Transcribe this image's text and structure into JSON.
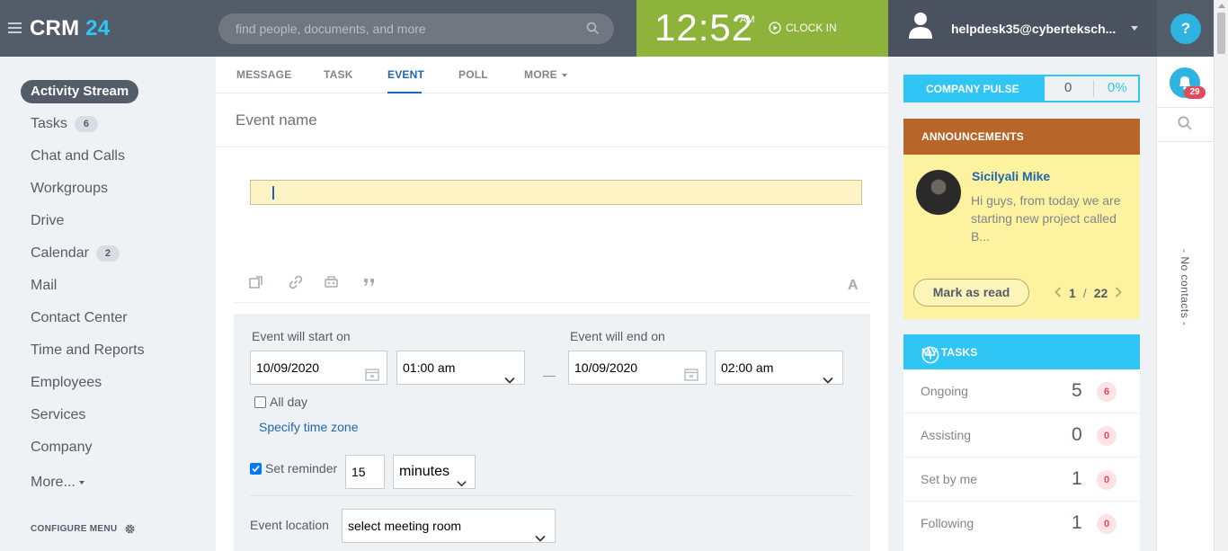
{
  "header": {
    "logo_main": "CRM",
    "logo_num": "24",
    "search_placeholder": "find people, documents, and more",
    "time": "12:52",
    "ampm": "AM",
    "clock_in": "CLOCK IN",
    "user": "helpdesk35@cyberteksch...",
    "help": "?"
  },
  "menu": {
    "active": "Activity Stream",
    "items": [
      {
        "label": "Tasks",
        "count": "6"
      },
      {
        "label": "Chat and Calls"
      },
      {
        "label": "Workgroups"
      },
      {
        "label": "Drive"
      },
      {
        "label": "Calendar",
        "count": "2"
      },
      {
        "label": "Mail"
      },
      {
        "label": "Contact Center"
      },
      {
        "label": "Time and Reports"
      },
      {
        "label": "Employees"
      },
      {
        "label": "Services"
      },
      {
        "label": "Company"
      }
    ],
    "more": "More...",
    "configure": "CONFIGURE MENU"
  },
  "form": {
    "tabs": [
      "MESSAGE",
      "TASK",
      "EVENT",
      "POLL",
      "MORE"
    ],
    "active_tab": "EVENT",
    "event_name_placeholder": "Event name",
    "format_label": "A",
    "start_label": "Event will start on",
    "end_label": "Event will end on",
    "start_date": "10/09/2020",
    "start_time": "01:00 am",
    "end_date": "10/09/2020",
    "end_time": "02:00 am",
    "dash": "—",
    "all_day": "All day",
    "all_day_checked": false,
    "timezone_link": "Specify time zone",
    "reminder_label": "Set reminder",
    "reminder_checked": true,
    "reminder_value": "15",
    "reminder_unit": "minutes",
    "location_label": "Event location",
    "location_value": "select meeting room"
  },
  "right": {
    "pulse_title": "COMPANY PULSE",
    "pulse_value": "0",
    "pulse_percent": "0%",
    "ann_title": "ANNOUNCEMENTS",
    "ann_author": "Sicilyali Mike",
    "ann_text": "Hi guys, from today we are starting new project called B...",
    "ann_button": "Mark as read",
    "ann_page": "1",
    "ann_sep": "/",
    "ann_total": "22",
    "tasks_title": "MY TASKS",
    "tasks": [
      {
        "name": "Ongoing",
        "count": "5",
        "badge": "6"
      },
      {
        "name": "Assisting",
        "count": "0",
        "badge": "0"
      },
      {
        "name": "Set by me",
        "count": "1",
        "badge": "0"
      },
      {
        "name": "Following",
        "count": "1",
        "badge": "0"
      }
    ]
  },
  "sidebar_right": {
    "notifications": "29",
    "no_contacts": "- No contacts -"
  },
  "colors": {
    "accent": "#2fc6f6",
    "clock_green": "#8db33b",
    "announcement_head": "#b8652a",
    "link": "#2067b0"
  }
}
